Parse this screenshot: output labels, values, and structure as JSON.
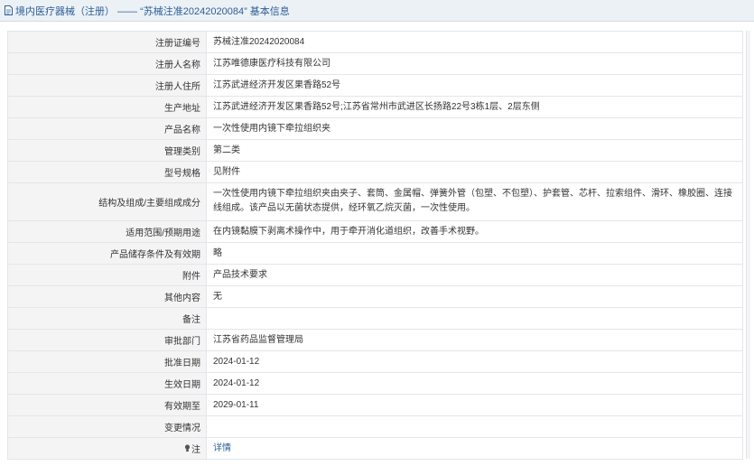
{
  "header": {
    "title": "境内医疗器械（注册） —— “苏械注准20242020084” 基本信息"
  },
  "record": {
    "rows": [
      {
        "label": "注册证编号",
        "value": "苏械注准20242020084"
      },
      {
        "label": "注册人名称",
        "value": "江苏唯德康医疗科技有限公司"
      },
      {
        "label": "注册人住所",
        "value": "江苏武进经济开发区果香路52号"
      },
      {
        "label": "生产地址",
        "value": "江苏武进经济开发区果香路52号;江苏省常州市武进区长扬路22号3栋1层、2层东侧"
      },
      {
        "label": "产品名称",
        "value": "一次性使用内镜下牵拉组织夹"
      },
      {
        "label": "管理类别",
        "value": "第二类"
      },
      {
        "label": "型号规格",
        "value": "见附件"
      },
      {
        "label": "结构及组成/主要组成成分",
        "value": "一次性使用内镜下牵拉组织夹由夹子、套筒、金属帽、弹簧外管（包塑、不包塑）、护套管、芯杆、拉索组件、滑环、橡胶圈、连接线组成。该产品以无菌状态提供，经环氧乙烷灭菌，一次性使用。"
      },
      {
        "label": "适用范围/预期用途",
        "value": "在内镜黏膜下剥离术操作中，用于牵开消化道组织，改善手术视野。"
      },
      {
        "label": "产品储存条件及有效期",
        "value": "略"
      },
      {
        "label": "附件",
        "value": "产品技术要求"
      },
      {
        "label": "其他内容",
        "value": "无"
      },
      {
        "label": "备注",
        "value": ""
      },
      {
        "label": "审批部门",
        "value": "江苏省药品监督管理局"
      },
      {
        "label": "批准日期",
        "value": "2024-01-12"
      },
      {
        "label": "生效日期",
        "value": "2024-01-12"
      },
      {
        "label": "有效期至",
        "value": "2029-01-11"
      },
      {
        "label": "变更情况",
        "value": ""
      }
    ],
    "note_label": "注",
    "note_link": "详情"
  }
}
